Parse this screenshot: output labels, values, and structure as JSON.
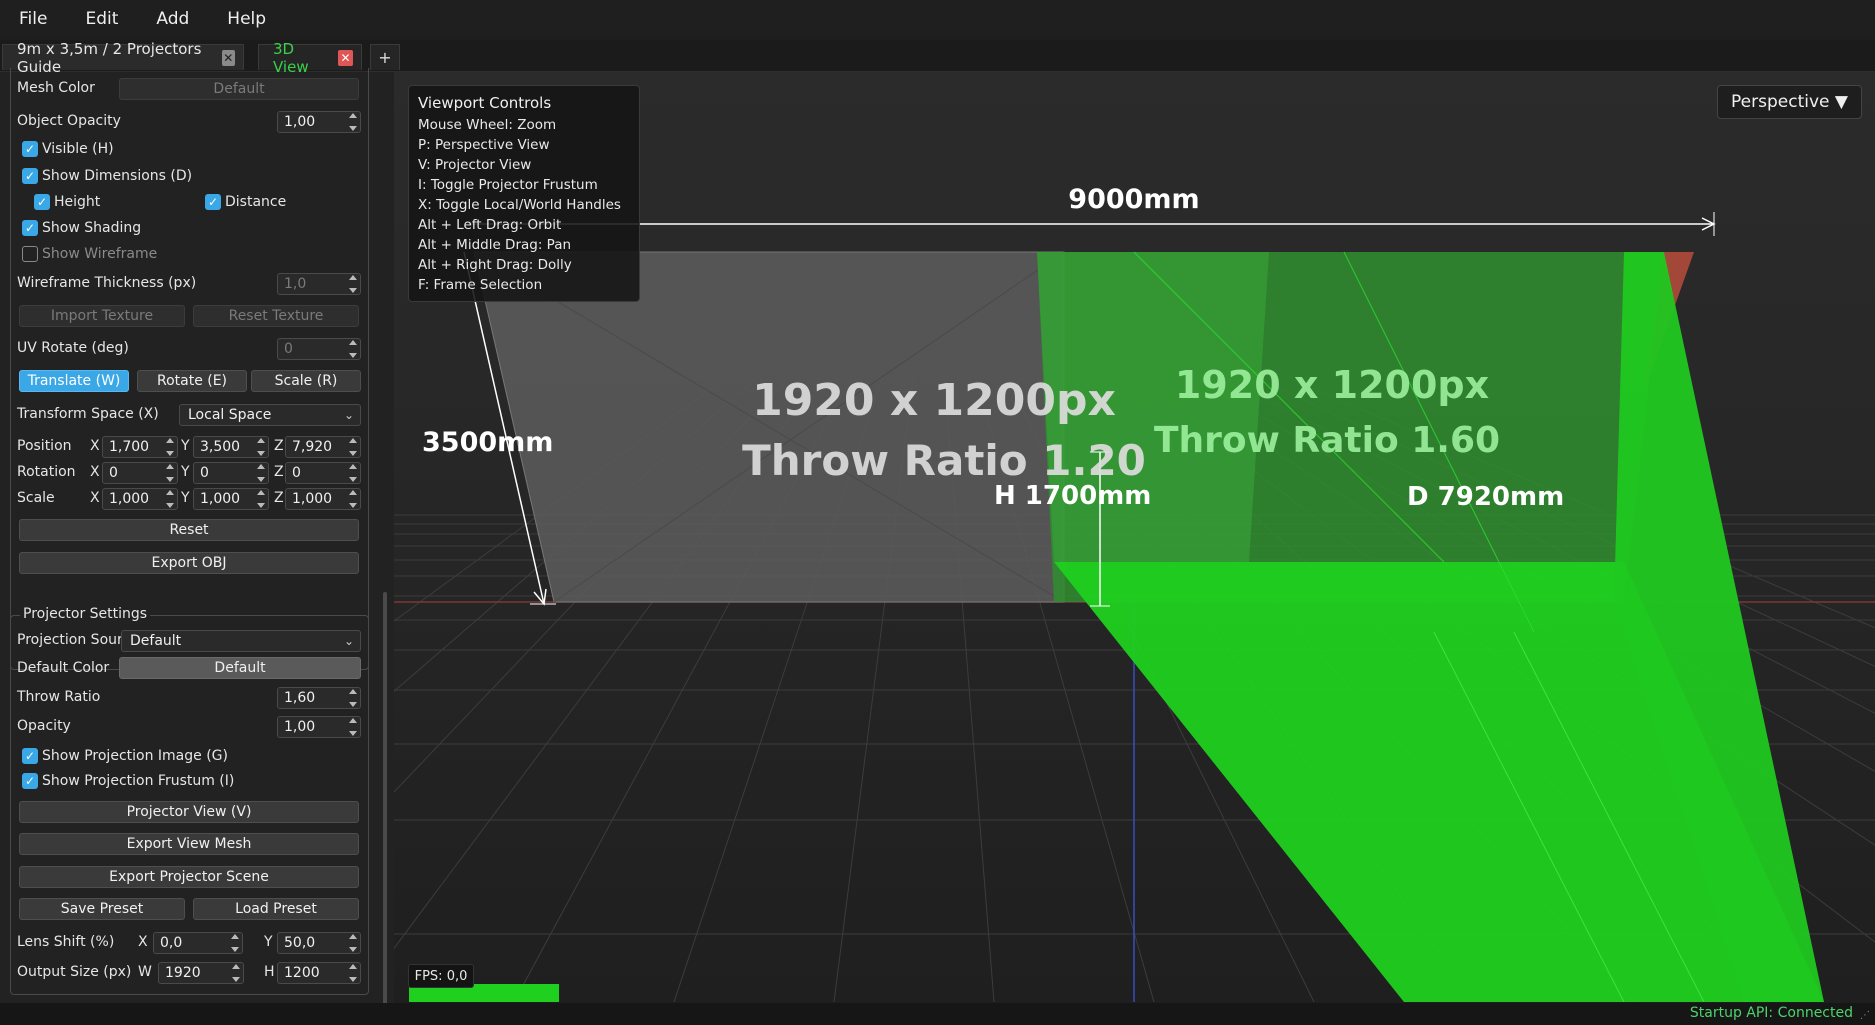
{
  "menu": [
    "File",
    "Edit",
    "Add",
    "Help"
  ],
  "tabs": [
    {
      "label": "9m x 3,5m / 2 Projectors Guide",
      "close": "✕"
    },
    {
      "label": "3D View",
      "close": "✕"
    }
  ],
  "tab_add": "+",
  "object": {
    "mesh_color_label": "Mesh Color",
    "mesh_color_value": "Default",
    "opacity_label": "Object Opacity",
    "opacity_value": "1,00",
    "visible_label": "Visible (H)",
    "show_dimensions_label": "Show Dimensions (D)",
    "height_label": "Height",
    "distance_label": "Distance",
    "show_shading_label": "Show Shading",
    "show_wireframe_label": "Show Wireframe",
    "wire_thickness_label": "Wireframe Thickness (px)",
    "wire_thickness_value": "1,0",
    "import_texture": "Import Texture",
    "reset_texture": "Reset Texture",
    "uv_rotate_label": "UV Rotate (deg)",
    "uv_rotate_value": "0",
    "translate": "Translate (W)",
    "rotate": "Rotate (E)",
    "scale": "Scale (R)",
    "transform_space_label": "Transform Space (X)",
    "transform_space_value": "Local Space",
    "position_label": "Position",
    "rotation_label": "Rotation",
    "scale_label": "Scale",
    "x": "X",
    "y": "Y",
    "z": "Z",
    "position": {
      "x": "1,700",
      "y": "3,500",
      "z": "7,920"
    },
    "rotation": {
      "x": "0",
      "y": "0",
      "z": "0"
    },
    "scale_v": {
      "x": "1,000",
      "y": "1,000",
      "z": "1,000"
    },
    "reset": "Reset",
    "export_obj": "Export OBJ"
  },
  "projector": {
    "title": "Projector Settings",
    "source_label": "Projection Sour",
    "source_value": "Default",
    "default_color_label": "Default Color",
    "default_color_value": "Default",
    "throw_ratio_label": "Throw Ratio",
    "throw_ratio_value": "1,60",
    "opacity_label": "Opacity",
    "opacity_value": "1,00",
    "show_image_label": "Show Projection Image (G)",
    "show_frustum_label": "Show Projection Frustum (I)",
    "projector_view": "Projector View (V)",
    "export_view_mesh": "Export View Mesh",
    "export_scene": "Export Projector Scene",
    "save_preset": "Save Preset",
    "load_preset": "Load Preset",
    "lens_shift_label": "Lens Shift (%)",
    "lens_x_label": "X",
    "lens_x": "0,0",
    "lens_y_label": "Y",
    "lens_y": "50,0",
    "output_size_label": "Output Size (px)",
    "w_label": "W",
    "w": "1920",
    "h_label": "H",
    "h": "1200"
  },
  "viewport_controls": {
    "title": "Viewport Controls",
    "lines": [
      "Mouse Wheel: Zoom",
      "P: Perspective View",
      "V: Projector View",
      "I: Toggle Projector Frustum",
      "X: Toggle Local/World Handles",
      "Alt + Left Drag: Orbit",
      "Alt + Middle Drag: Pan",
      "Alt + Right Drag: Dolly",
      "F: Frame Selection"
    ]
  },
  "perspective_button": "Perspective ▼",
  "scene": {
    "width_dim": "9000mm",
    "height_dim": "3500mm",
    "h_dim": "H 1700mm",
    "d_dim": "D 7920mm",
    "proj1_res": "1920 x 1200px",
    "proj1_throw": "Throw Ratio 1.20",
    "proj2_res": "1920 x 1200px",
    "proj2_throw": "Throw Ratio 1.60",
    "green": "#22d022",
    "grid": "#3a3a3a"
  },
  "fps": "FPS: 0,0",
  "status": "Startup API: Connected"
}
